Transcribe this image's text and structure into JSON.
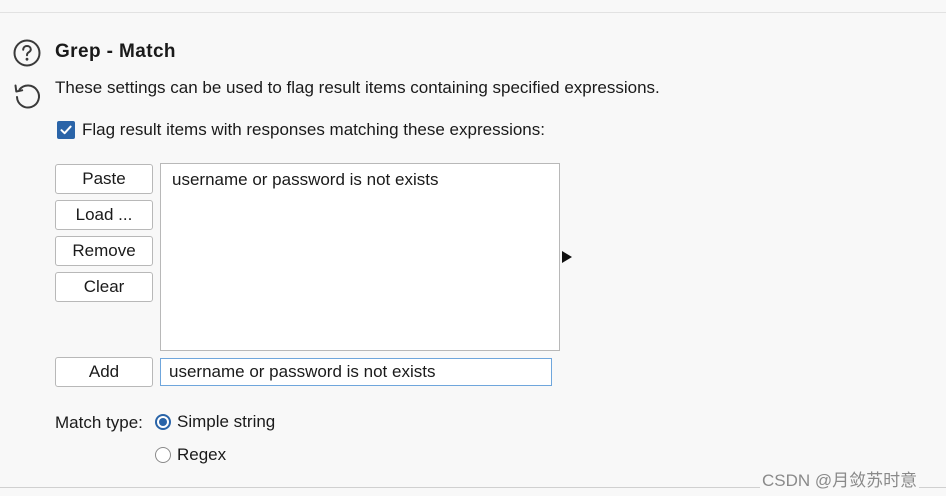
{
  "section": {
    "title": "Grep - Match",
    "description": "These settings can be used to flag result items containing specified expressions."
  },
  "flag": {
    "label": "Flag result items with responses matching these expressions:",
    "checked": true
  },
  "buttons": {
    "paste": "Paste",
    "load": "Load ...",
    "remove": "Remove",
    "clear": "Clear",
    "add": "Add"
  },
  "expressions": [
    "username or password is not exists"
  ],
  "add_input": {
    "value": "username or password is not exists"
  },
  "match_type": {
    "label": "Match type:",
    "options": [
      {
        "label": "Simple string",
        "selected": true
      },
      {
        "label": "Regex",
        "selected": false
      }
    ]
  },
  "watermark": "CSDN @月敛苏时意",
  "icons": {
    "help": "help-icon",
    "reset": "reset-icon",
    "check": "check-icon"
  },
  "colors": {
    "accent": "#2a64a8",
    "input_focus_border": "#6fa6dc",
    "background": "#f8f8f8"
  }
}
